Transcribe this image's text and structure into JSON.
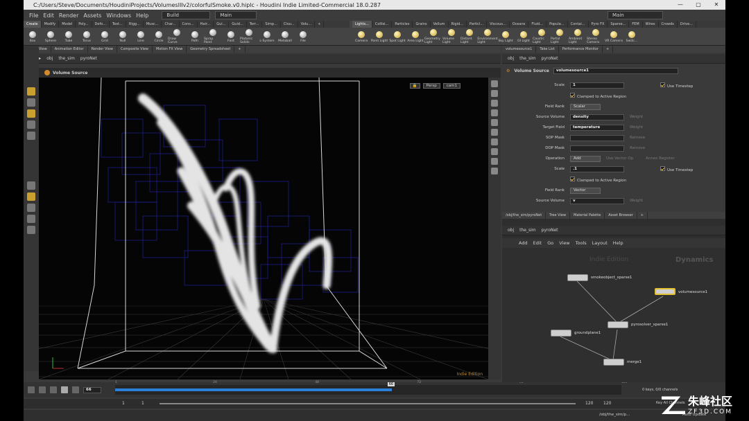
{
  "window": {
    "title": "C:/Users/Steve/Documents/HoudiniProjects/VolumesIIIv2/colorfulSmoke.v0.hiplc - Houdini Indie Limited-Commercial 18.0.287",
    "min": "—",
    "max": "▢",
    "close": "✕"
  },
  "menubar": {
    "items": [
      "File",
      "Edit",
      "Render",
      "Assets",
      "Windows",
      "Help"
    ],
    "desktop": "Build",
    "pane": "Main",
    "right_desktop": "Main"
  },
  "shelf_left": {
    "tabs": [
      "Create",
      "Modify",
      "Model",
      "Poly...",
      "Defo...",
      "Text...",
      "Rigg...",
      "Musc...",
      "Char...",
      "Cons...",
      "Hair...",
      "Gui...",
      "Guid...",
      "Terr...",
      "Simp...",
      "Clou...",
      "Volu...",
      "+"
    ],
    "tools": [
      "Box",
      "Sphere",
      "Tube",
      "Torus",
      "Grid",
      "Null",
      "Line",
      "Circle",
      "Draw Curve",
      "Path",
      "Spray Paint",
      "Font",
      "Platonic Solids",
      "L-System",
      "Metaball",
      "File"
    ]
  },
  "shelf_right": {
    "tabs": [
      "Lights...",
      "Collisi...",
      "Particles",
      "Grains",
      "Vellum",
      "Rigid...",
      "Particl...",
      "Viscous...",
      "Oceans",
      "Fluid...",
      "Popula...",
      "Contai...",
      "Pyro FX",
      "Sparse...",
      "FEM",
      "Wires",
      "Crowds",
      "Drive..."
    ],
    "tools": [
      "Camera",
      "Point Light",
      "Spot Light",
      "Area Light",
      "Geometry Light",
      "Volume Light",
      "Distant Light",
      "Environment Light",
      "Sky Light",
      "GI Light",
      "Caustic Light",
      "Portal Light",
      "Ambient Light",
      "Stereo Camera",
      "VR Camera",
      "Switc..."
    ]
  },
  "viewer": {
    "tabs": [
      "Scene View",
      "Animation Editor",
      "Render View",
      "Composite View",
      "Motion FX View",
      "Geometry Spreadsheet",
      "+"
    ],
    "path": [
      "obj",
      "the_sim",
      "pyroNet"
    ],
    "node_label": "Volume Source",
    "persp": "Persp",
    "cam": "cam1",
    "watermark": "Indie Edition"
  },
  "params": {
    "tabs": [
      "volumesource1",
      "Take List",
      "Performance Monitor",
      "+"
    ],
    "path": [
      "obj",
      "the_sim",
      "pyroNet"
    ],
    "node_type": "Volume Source",
    "node_name": "volumesource1",
    "rows": [
      {
        "label": "Scale",
        "value": "1",
        "check": "Use Timestep"
      },
      {
        "label": "",
        "check": "Clamped to Active Region"
      },
      {
        "label": "Field Rank",
        "menu": "Scalar"
      },
      {
        "label": "Source Volume",
        "value": "density",
        "extra": "Weight"
      },
      {
        "label": "Target Field",
        "value": "temperature",
        "extra": "Weight"
      },
      {
        "label": "SOP Mask",
        "value": "",
        "extra": "Remove"
      },
      {
        "label": "DOP Mask",
        "value": "",
        "extra": "Remove"
      },
      {
        "label": "Operation",
        "menu": "Add",
        "extra": "Use Vector Op",
        "extra2": "Annex Register"
      },
      {
        "label": "Scale",
        "value": ".1",
        "check": "Use Timestep"
      },
      {
        "label": "",
        "check": "Clamped to Active Region"
      },
      {
        "label": "Field Rank",
        "menu": "Vector"
      },
      {
        "label": "Source Volume",
        "value": "v",
        "extra": "Weight"
      }
    ]
  },
  "network": {
    "tabs": [
      "/obj/the_sim/pyroNet",
      "Tree View",
      "Material Palette",
      "Asset Browser",
      "+"
    ],
    "path": [
      "obj",
      "the_sim",
      "pyroNet"
    ],
    "menu": [
      "Add",
      "Edit",
      "Go",
      "View",
      "Tools",
      "Layout",
      "Help"
    ],
    "watermark": "Indie Edition",
    "context": "Dynamics",
    "nodes": [
      {
        "name": "smokeobject_sparse1"
      },
      {
        "name": "volumesource1"
      },
      {
        "name": "pyrosolver_sparse1"
      },
      {
        "name": "groundplane1"
      },
      {
        "name": "merge1"
      }
    ]
  },
  "timeline": {
    "frame": "66",
    "start": "1",
    "end": "120",
    "range_start": "1",
    "range_startb": "1",
    "range_end": "120",
    "range_endb": "120",
    "ticks": [
      "1",
      "24",
      "48",
      "66",
      "72",
      "96",
      "120"
    ],
    "keys": "0 keys, 0/0 channels",
    "key_all": "Key All Channels",
    "auto_update": "Auto Update",
    "status_path": "/obj/the_sim/p..."
  },
  "site_watermark": {
    "text": "朱峰社区",
    "url": "ZF3D.COM"
  }
}
